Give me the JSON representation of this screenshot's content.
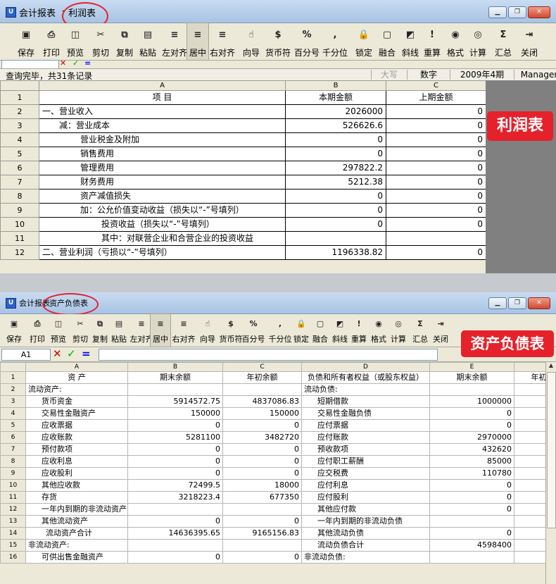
{
  "win1": {
    "title_app": "会计报表",
    "title_doc": "利润表",
    "status_left": "查询完毕，共31条记录",
    "status_cells": [
      "大写",
      "数字",
      "2009年4期",
      "Manager"
    ],
    "badge": "利润表",
    "col_headers": [
      "A",
      "B",
      "C"
    ],
    "rows": [
      {
        "n": "1",
        "a": "项    目",
        "b": "本期金额",
        "c": "上期金额"
      },
      {
        "n": "2",
        "a": "一、营业收入",
        "b": "2026000",
        "c": "0"
      },
      {
        "n": "3",
        "a": "减：营业成本",
        "b": "526626.6",
        "c": "0"
      },
      {
        "n": "4",
        "a": "营业税金及附加",
        "b": "0",
        "c": "0"
      },
      {
        "n": "5",
        "a": "销售费用",
        "b": "0",
        "c": "0"
      },
      {
        "n": "6",
        "a": "管理费用",
        "b": "297822.2",
        "c": "0"
      },
      {
        "n": "7",
        "a": "财务费用",
        "b": "5212.38",
        "c": "0"
      },
      {
        "n": "8",
        "a": "资产减值损失",
        "b": "0",
        "c": "0"
      },
      {
        "n": "9",
        "a": "加：公允价值变动收益（损失以“-”号填列）",
        "b": "0",
        "c": "0"
      },
      {
        "n": "10",
        "a": "投资收益（损失以“-”号填列）",
        "b": "0",
        "c": "0"
      },
      {
        "n": "11",
        "a": "其中：对联营企业和合营企业的投资收益",
        "b": "",
        "c": ""
      },
      {
        "n": "12",
        "a": "二、营业利润（亏损以“-”号填列）",
        "b": "1196338.82",
        "c": "0"
      }
    ]
  },
  "toolbar": {
    "buttons": [
      {
        "label": "保存",
        "icon": "▣"
      },
      {
        "label": "打印",
        "icon": "⎙"
      },
      {
        "label": "预览",
        "icon": "◫"
      },
      {
        "label": "剪切",
        "icon": "✂"
      },
      {
        "label": "复制",
        "icon": "⧉"
      },
      {
        "label": "粘贴",
        "icon": "▤"
      },
      {
        "label": "左对齐",
        "icon": "≡"
      },
      {
        "label": "居中",
        "icon": "≡"
      },
      {
        "label": "右对齐",
        "icon": "≡"
      },
      {
        "label": "向导",
        "icon": "☝"
      },
      {
        "label": "货币符",
        "icon": "$"
      },
      {
        "label": "百分号",
        "icon": "%"
      },
      {
        "label": "千分位",
        "icon": ","
      },
      {
        "label": "锁定",
        "icon": "🔒"
      },
      {
        "label": "融合",
        "icon": "▢"
      },
      {
        "label": "斜线",
        "icon": "◩"
      },
      {
        "label": "重算",
        "icon": "!"
      },
      {
        "label": "格式",
        "icon": "◉"
      },
      {
        "label": "计算",
        "icon": "◎"
      },
      {
        "label": "汇总",
        "icon": "Σ"
      },
      {
        "label": "关闭",
        "icon": "⇥"
      }
    ]
  },
  "win2": {
    "title_app": "会计报表",
    "title_doc": "资产负债表",
    "cell_ref": "A1",
    "badge": "资产负债表",
    "col_headers": [
      "A",
      "B",
      "C",
      "D",
      "E"
    ],
    "rows": [
      {
        "n": "1",
        "a": "资      产",
        "b": "期末余额",
        "c": "年初余额",
        "d": "负债和所有者权益（或股东权益）",
        "e": "期末余额",
        "f": "年初"
      },
      {
        "n": "2",
        "a": "流动资产:",
        "b": "",
        "c": "",
        "d": "流动负债:",
        "e": "",
        "f": ""
      },
      {
        "n": "3",
        "a": "货币资金",
        "b": "5914572.75",
        "c": "4837086.83",
        "d": "短期借款",
        "e": "1000000",
        "f": ""
      },
      {
        "n": "4",
        "a": "交易性金融资产",
        "b": "150000",
        "c": "150000",
        "d": "交易性金融负债",
        "e": "0",
        "f": ""
      },
      {
        "n": "5",
        "a": "应收票据",
        "b": "0",
        "c": "0",
        "d": "应付票据",
        "e": "0",
        "f": ""
      },
      {
        "n": "6",
        "a": "应收账款",
        "b": "5281100",
        "c": "3482720",
        "d": "应付账款",
        "e": "2970000",
        "f": ""
      },
      {
        "n": "7",
        "a": "预付款项",
        "b": "0",
        "c": "0",
        "d": "预收款项",
        "e": "432620",
        "f": ""
      },
      {
        "n": "8",
        "a": "应收利息",
        "b": "0",
        "c": "0",
        "d": "应付职工薪酬",
        "e": "85000",
        "f": ""
      },
      {
        "n": "9",
        "a": "应收股利",
        "b": "0",
        "c": "0",
        "d": "应交税费",
        "e": "110780",
        "f": ""
      },
      {
        "n": "10",
        "a": "其他应收款",
        "b": "72499.5",
        "c": "18000",
        "d": "应付利息",
        "e": "0",
        "f": ""
      },
      {
        "n": "11",
        "a": "存货",
        "b": "3218223.4",
        "c": "677350",
        "d": "应付股利",
        "e": "0",
        "f": ""
      },
      {
        "n": "12",
        "a": "一年内到期的非流动资产",
        "b": "",
        "c": "",
        "d": "其他应付款",
        "e": "0",
        "f": ""
      },
      {
        "n": "13",
        "a": "其他流动资产",
        "b": "0",
        "c": "0",
        "d": "一年内到期的非流动负债",
        "e": "",
        "f": ""
      },
      {
        "n": "14",
        "a": "流动资产合计",
        "b": "14636395.65",
        "c": "9165156.83",
        "d": "其他流动负债",
        "e": "0",
        "f": ""
      },
      {
        "n": "15",
        "a": "非流动资产:",
        "b": "",
        "c": "",
        "d": "流动负债合计",
        "e": "4598400",
        "f": ""
      },
      {
        "n": "16",
        "a": "可供出售金融资产",
        "b": "0",
        "c": "0",
        "d": "非流动负债:",
        "e": "",
        "f": ""
      }
    ]
  }
}
